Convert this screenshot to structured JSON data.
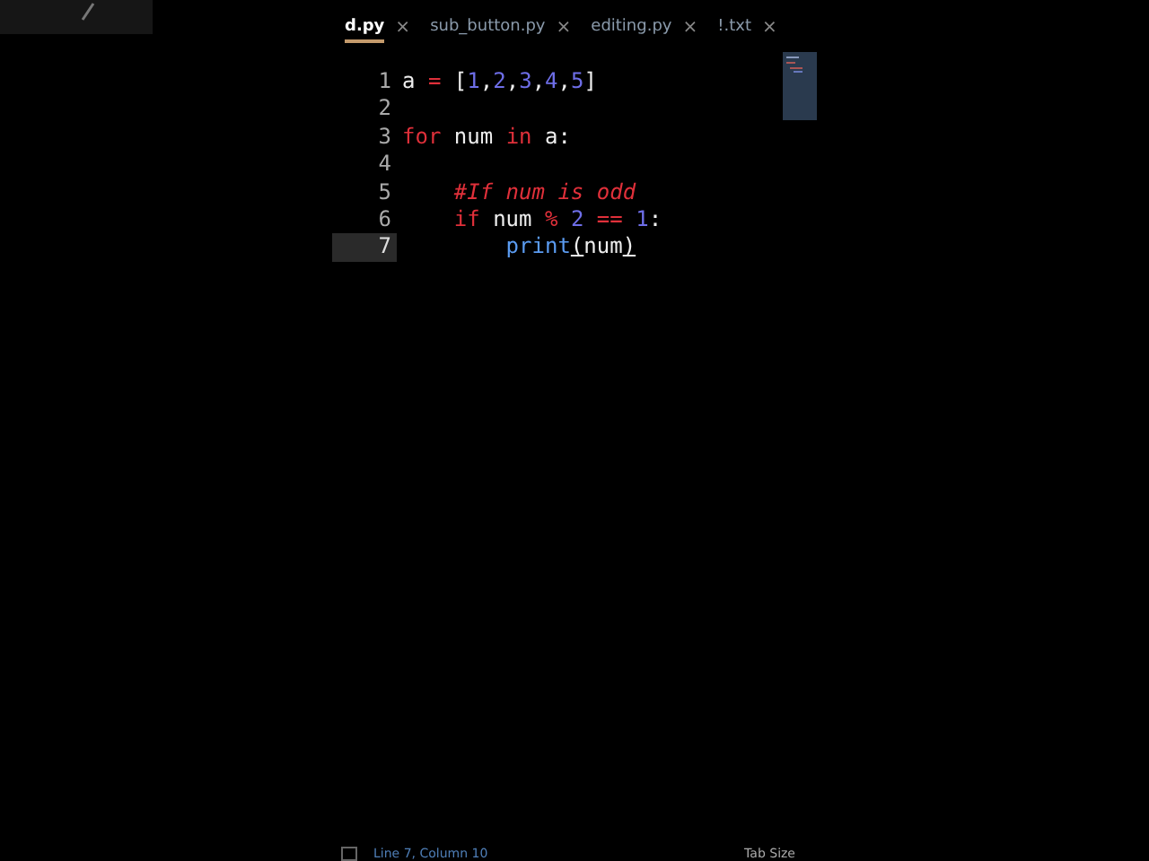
{
  "tabs": [
    {
      "label": "d.py",
      "close": "×",
      "selected": true
    },
    {
      "label": "sub_button.py",
      "close": "×",
      "selected": false
    },
    {
      "label": "editing.py",
      "close": "×",
      "selected": false
    },
    {
      "label": "!.txt",
      "close": "×",
      "selected": false
    }
  ],
  "editor": {
    "lines": [
      {
        "number": "1",
        "current": false,
        "tokens": [
          {
            "kind": "name",
            "text": "a "
          },
          {
            "kind": "operator",
            "text": "="
          },
          {
            "kind": "punct",
            "text": " ["
          },
          {
            "kind": "number",
            "text": "1"
          },
          {
            "kind": "punct",
            "text": ","
          },
          {
            "kind": "number",
            "text": "2"
          },
          {
            "kind": "punct",
            "text": ","
          },
          {
            "kind": "number",
            "text": "3"
          },
          {
            "kind": "punct",
            "text": ","
          },
          {
            "kind": "number",
            "text": "4"
          },
          {
            "kind": "punct",
            "text": ","
          },
          {
            "kind": "number",
            "text": "5"
          },
          {
            "kind": "punct",
            "text": "]"
          }
        ]
      },
      {
        "number": "2",
        "current": false
      },
      {
        "number": "3",
        "current": false,
        "tokens": [
          {
            "kind": "keyword",
            "text": "for"
          },
          {
            "kind": "name",
            "text": " num "
          },
          {
            "kind": "keyword",
            "text": "in"
          },
          {
            "kind": "name",
            "text": " a:"
          }
        ]
      },
      {
        "number": "4",
        "current": false
      },
      {
        "number": "5",
        "current": false,
        "tokens": [
          {
            "kind": "comment",
            "text": "    #If num is odd"
          }
        ]
      },
      {
        "number": "6",
        "current": false,
        "tokens": [
          {
            "kind": "keyword",
            "text": "    if"
          },
          {
            "kind": "name",
            "text": " num "
          },
          {
            "kind": "operator",
            "text": "%"
          },
          {
            "kind": "number",
            "text": " 2"
          },
          {
            "kind": "operator",
            "text": " =="
          },
          {
            "kind": "number",
            "text": " 1"
          },
          {
            "kind": "punct",
            "text": ":"
          }
        ]
      },
      {
        "number": "7",
        "current": true,
        "tokens": [
          {
            "kind": "function",
            "text": "        print"
          },
          {
            "kind": "bracket",
            "text": "("
          },
          {
            "kind": "name",
            "text": "num"
          },
          {
            "kind": "bracket",
            "text": ")"
          }
        ]
      }
    ]
  },
  "status_bar": {
    "position": "Line 7, Column 10",
    "tab_size": "Tab Size"
  }
}
